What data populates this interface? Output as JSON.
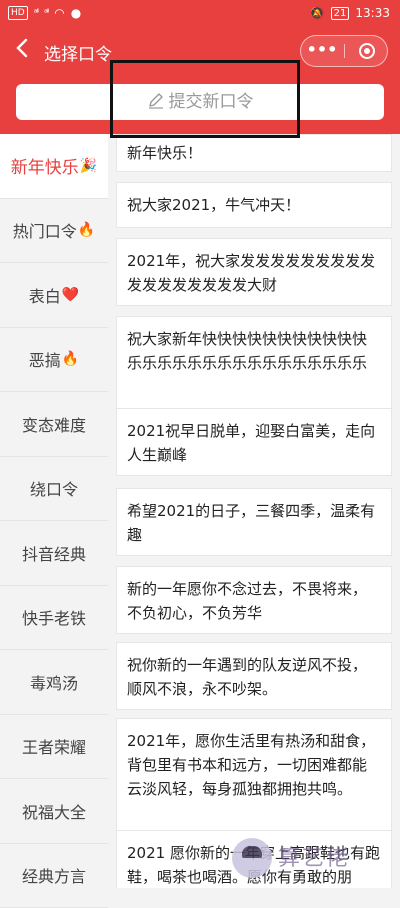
{
  "status_bar": {
    "left_items": [
      "HD",
      "4G",
      "46",
      "wifi",
      "wechat"
    ],
    "time": "13:33",
    "battery": "21"
  },
  "nav": {
    "title": "选择口令",
    "back_icon": "chevron-left-icon",
    "more_icon": "more-dots-icon",
    "close_icon": "target-circle-icon",
    "color": "#e8403f"
  },
  "submit": {
    "label": "提交新口令",
    "icon": "pencil-icon"
  },
  "sidebar": {
    "items": [
      {
        "label": "新年快乐",
        "emoji": "🎉",
        "active": true
      },
      {
        "label": "热门口令",
        "emoji": "🔥",
        "active": false
      },
      {
        "label": "表白",
        "emoji": "❤️",
        "active": false
      },
      {
        "label": "恶搞",
        "emoji": "🔥",
        "active": false
      },
      {
        "label": "变态难度",
        "emoji": "",
        "active": false
      },
      {
        "label": "绕口令",
        "emoji": "",
        "active": false
      },
      {
        "label": "抖音经典",
        "emoji": "",
        "active": false
      },
      {
        "label": "快手老铁",
        "emoji": "",
        "active": false
      },
      {
        "label": "毒鸡汤",
        "emoji": "",
        "active": false
      },
      {
        "label": "王者荣耀",
        "emoji": "",
        "active": false
      },
      {
        "label": "祝福大全",
        "emoji": "",
        "active": false
      },
      {
        "label": "经典方言",
        "emoji": "",
        "active": false
      }
    ]
  },
  "cards": [
    "新年快乐！",
    "祝大家2021，牛气冲天！",
    "2021年，祝大家发发发发发发发发发发发发发发发发发大财",
    "祝大家新年快快快快快快快快快快快乐乐乐乐乐乐乐乐乐乐乐乐乐乐乐乐",
    "2021祝早日脱单，迎娶白富美，走向人生巅峰",
    "希望2021的日子，三餐四季，温柔有趣",
    "新的一年愿你不念过去，不畏将来，不负初心，不负芳华",
    "祝你新的一年遇到的队友逆风不投，顺风不浪，永不吵架。",
    "2021年，愿你生活里有热汤和甜食，背包里有书本和远方，一切困难都能云淡风轻，每身孤独都拥抱共鸣。",
    "2021 愿你新的一年穿上高跟鞋也有跑鞋，喝茶也喝酒。愿你有勇敢的朋"
  ],
  "watermark": {
    "text": "算艺佬"
  }
}
